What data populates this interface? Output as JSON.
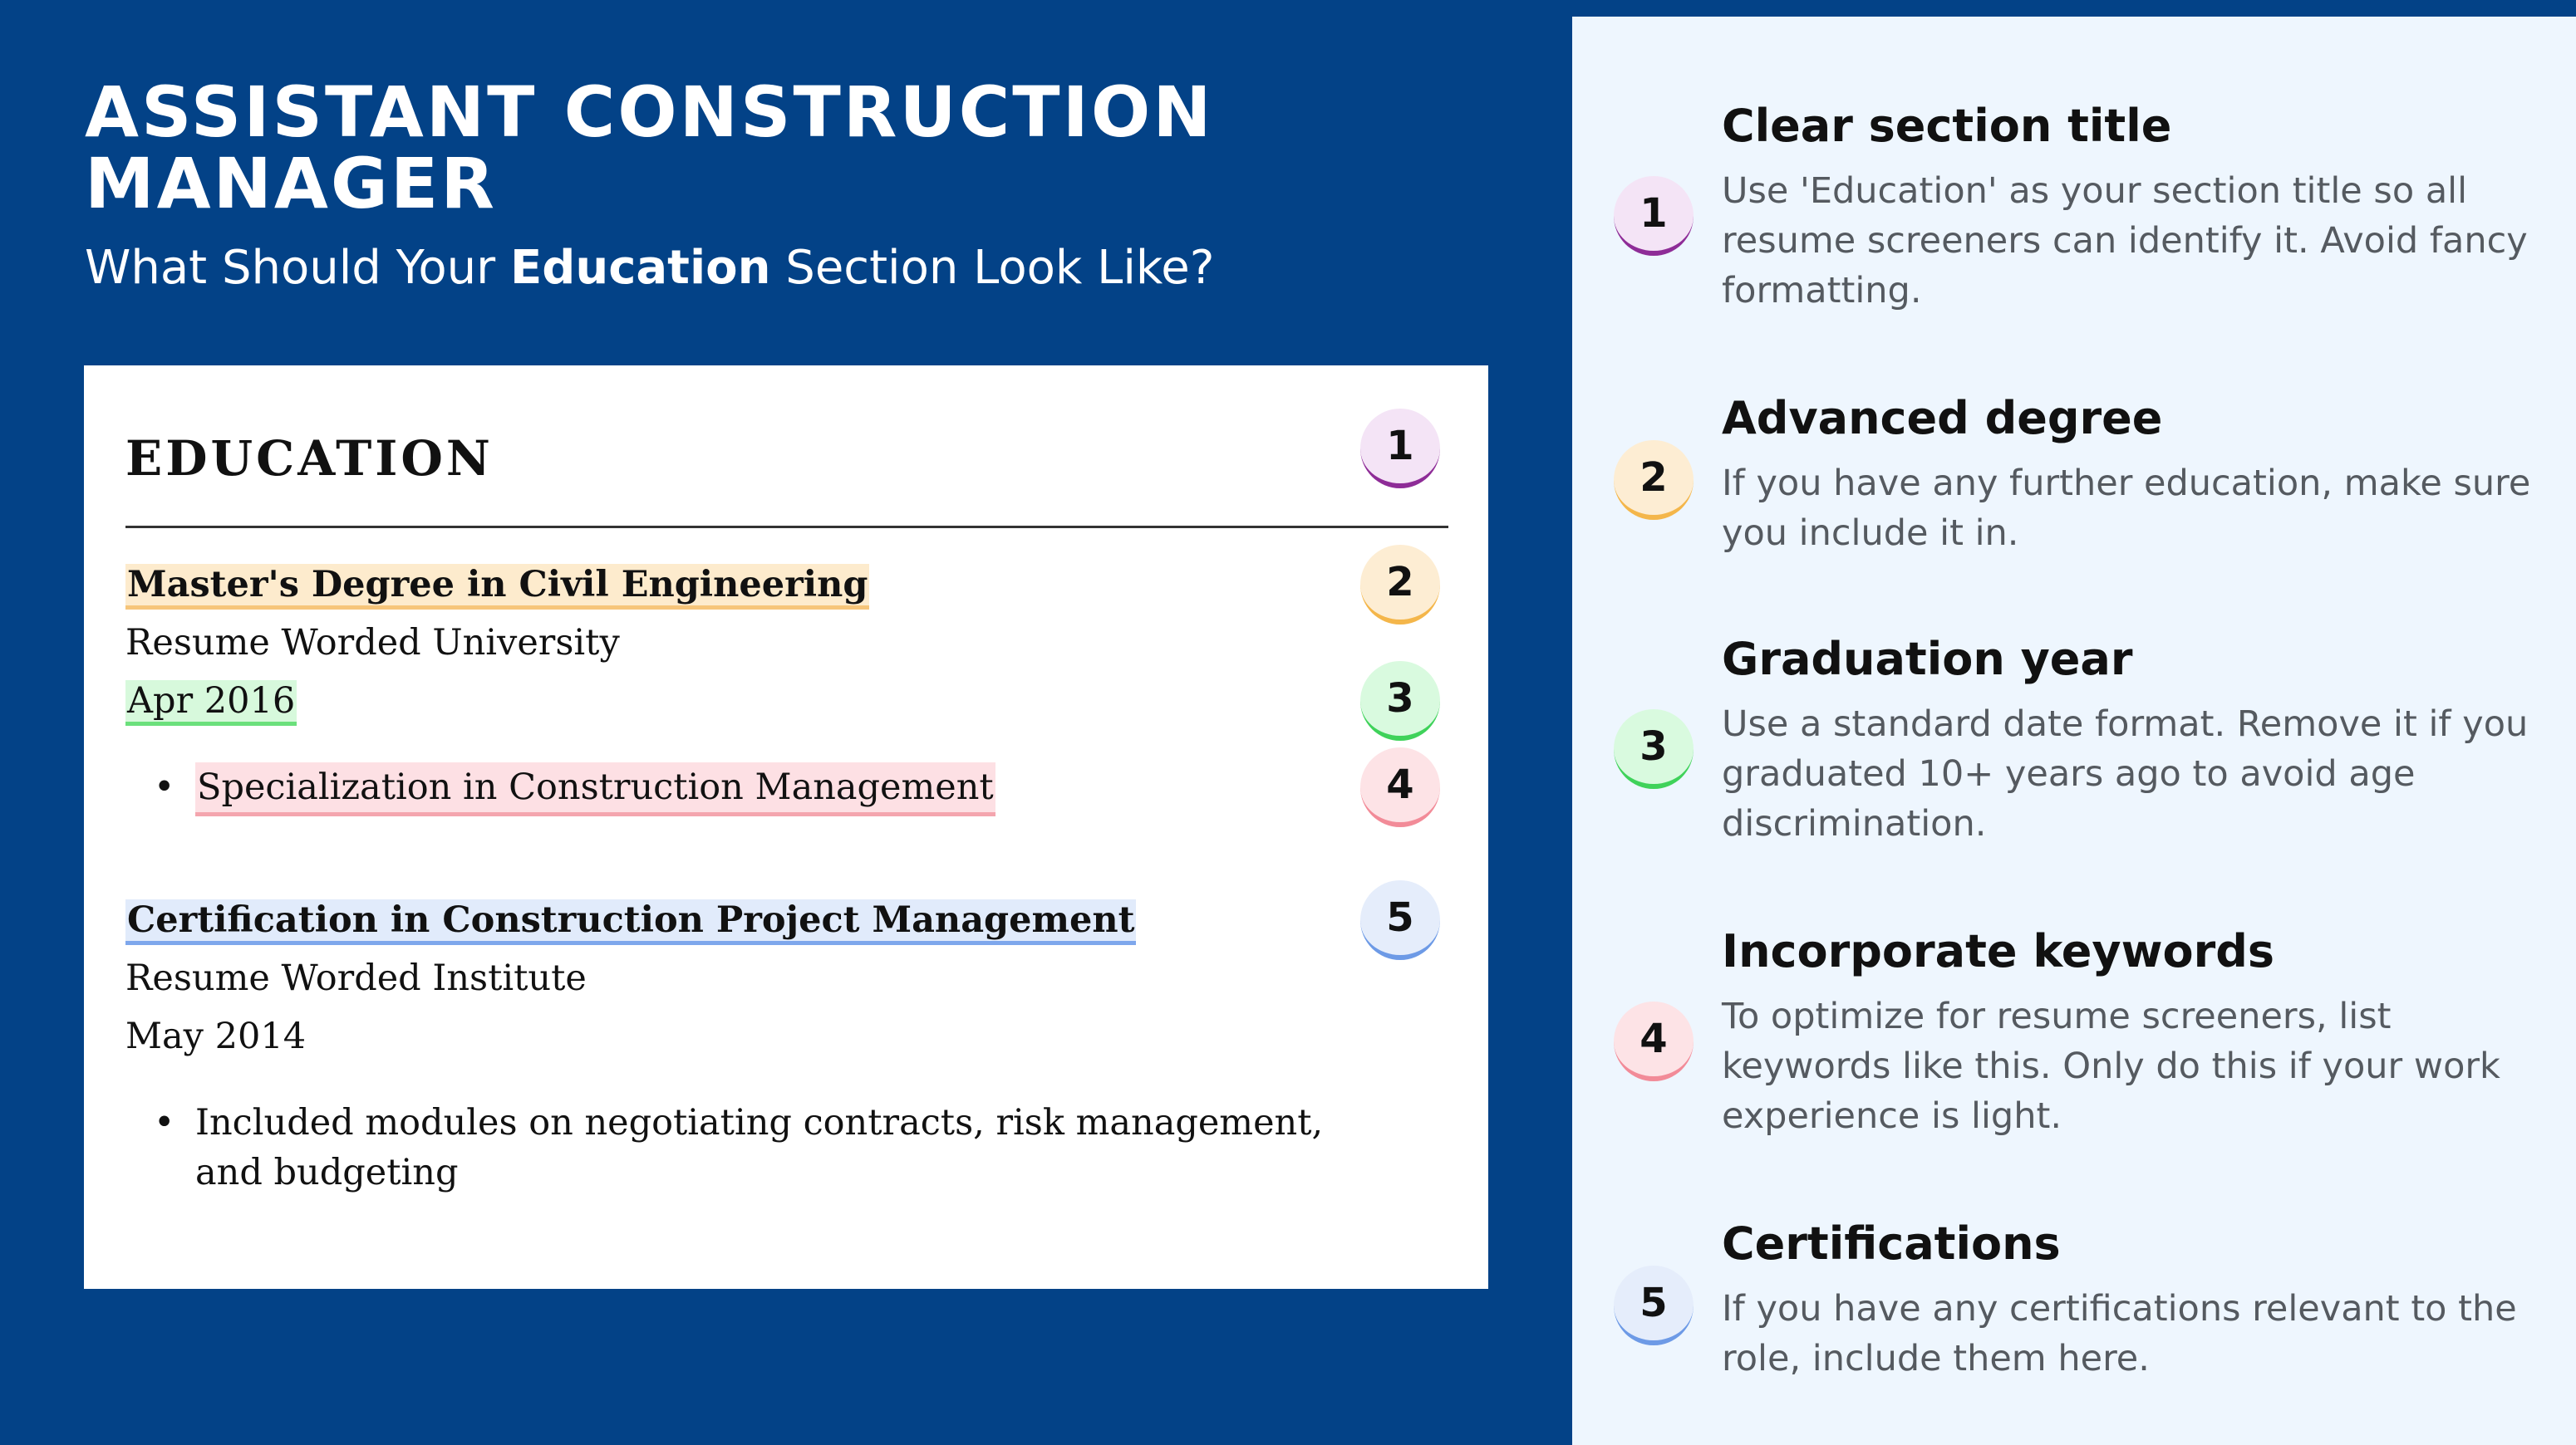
{
  "header": {
    "title": "ASSISTANT CONSTRUCTION MANAGER",
    "subtitle_prefix": "What Should Your ",
    "subtitle_bold": "Education",
    "subtitle_suffix": " Section Look Like?"
  },
  "resume": {
    "section_heading": "EDUCATION",
    "entries": [
      {
        "degree": "Master's Degree in Civil Engineering",
        "institution": "Resume Worded University",
        "date": "Apr 2016",
        "bullet": "Specialization in Construction Management"
      },
      {
        "degree": "Certification in Construction Project Management",
        "institution": "Resume Worded Institute",
        "date": "May 2014",
        "bullet": "Included modules on negotiating contracts, risk management, and budgeting"
      }
    ]
  },
  "badges": [
    "1",
    "2",
    "3",
    "4",
    "5"
  ],
  "badge_colors": [
    "#8e2c97",
    "#f4b64a",
    "#3fd25a",
    "#f28b98",
    "#6d9ae6"
  ],
  "tips": [
    {
      "number": "1",
      "title": "Clear section title",
      "body": "Use 'Education' as your section title so all resume screeners can identify it. Avoid fancy formatting."
    },
    {
      "number": "2",
      "title": "Advanced degree",
      "body": "If you have any further education, make sure you include it in."
    },
    {
      "number": "3",
      "title": "Graduation year",
      "body": "Use a standard date format. Remove it if you graduated 10+ years ago to avoid age discrimination."
    },
    {
      "number": "4",
      "title": "Incorporate keywords",
      "body": "To optimize for resume screeners, list keywords like this. Only do this if your work experience is light."
    },
    {
      "number": "5",
      "title": "Certifications",
      "body": "If you have any certifications relevant to the role, include them here."
    }
  ],
  "colors": {
    "background": "#034287",
    "panel": "#eef6fe",
    "card": "#ffffff"
  }
}
